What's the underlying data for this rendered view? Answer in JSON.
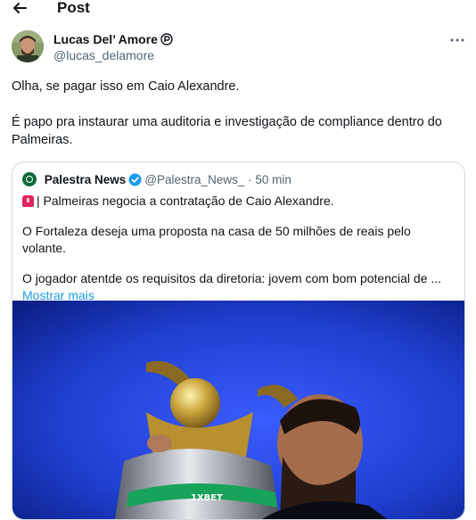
{
  "header": {
    "title": "Post",
    "back_icon": "back-arrow-icon"
  },
  "tweet": {
    "author": {
      "name": "Lucas Del’ Amore",
      "handle": "@lucas_delamore",
      "badge_icon": "pro-badge-icon"
    },
    "more_icon": "more-options-icon",
    "paragraphs": [
      "Olha, se pagar isso em Caio Alexandre.",
      "É papo pra instaurar uma auditoria e investigação de compliance dentro do Palmeiras."
    ]
  },
  "quote": {
    "author": {
      "name": "Palestra News",
      "handle": "@Palestra_News_",
      "separator": "·",
      "time": "50 min",
      "verified_icon": "verified-badge-icon"
    },
    "lines": [
      "| Palmeiras negocia a contratação de Caio Alexandre.",
      "O Fortaleza deseja uma proposta na casa de 50 milhões de reais pelo volante.",
      "O jogador atentde os requisitos da diretoria: jovem com bom potencial de ..."
    ],
    "show_more": "Mostrar mais",
    "media": {
      "kind": "photo",
      "subject": "player-kissing-trophy-image",
      "trophy_text": "1XBET"
    }
  },
  "colors": {
    "text": "#0f1419",
    "secondary": "#536471",
    "link": "#1d9bf0",
    "border": "#cfd9de",
    "photo_bg": "#1f3fd0"
  }
}
